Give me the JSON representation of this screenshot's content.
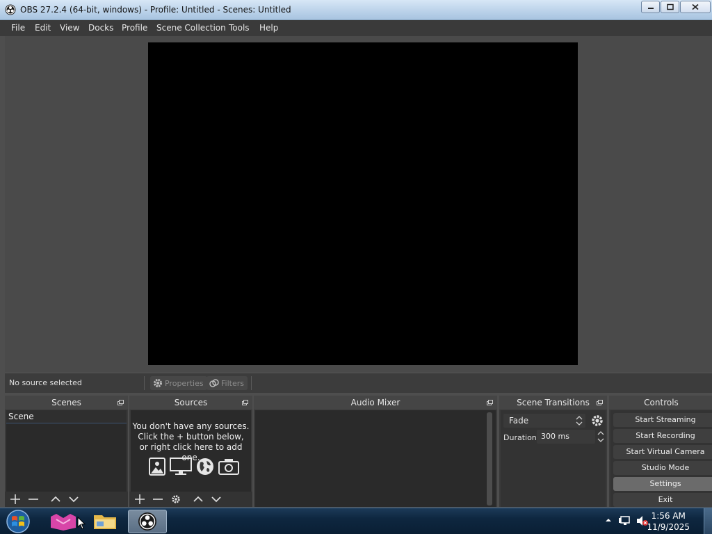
{
  "window": {
    "title": "OBS 27.2.4 (64-bit, windows) - Profile: Untitled - Scenes: Untitled"
  },
  "menu": {
    "items": [
      "File",
      "Edit",
      "View",
      "Docks",
      "Profile",
      "Scene Collection",
      "Tools",
      "Help"
    ]
  },
  "source_toolbar": {
    "status": "No source selected",
    "properties_label": "Properties",
    "filters_label": "Filters"
  },
  "docks": {
    "scenes": {
      "title": "Scenes",
      "items": [
        "Scene"
      ]
    },
    "sources": {
      "title": "Sources",
      "empty_lines": [
        "You don't have any sources.",
        "Click the + button below,",
        "or right click here to add one."
      ]
    },
    "audio_mixer": {
      "title": "Audio Mixer"
    },
    "scene_transitions": {
      "title": "Scene Transitions",
      "transition": "Fade",
      "duration_label": "Duration",
      "duration_value": "300 ms"
    },
    "controls": {
      "title": "Controls",
      "buttons": [
        "Start Streaming",
        "Start Recording",
        "Start Virtual Camera",
        "Studio Mode",
        "Settings",
        "Exit"
      ]
    }
  },
  "taskbar": {
    "time": "1:56 AM",
    "date": "11/9/2025"
  },
  "colors": {
    "accent": "#3d5574",
    "dock_bg": "#3a3a3a",
    "preview_bg": "#4a4a4a",
    "canvas": "#000000"
  }
}
